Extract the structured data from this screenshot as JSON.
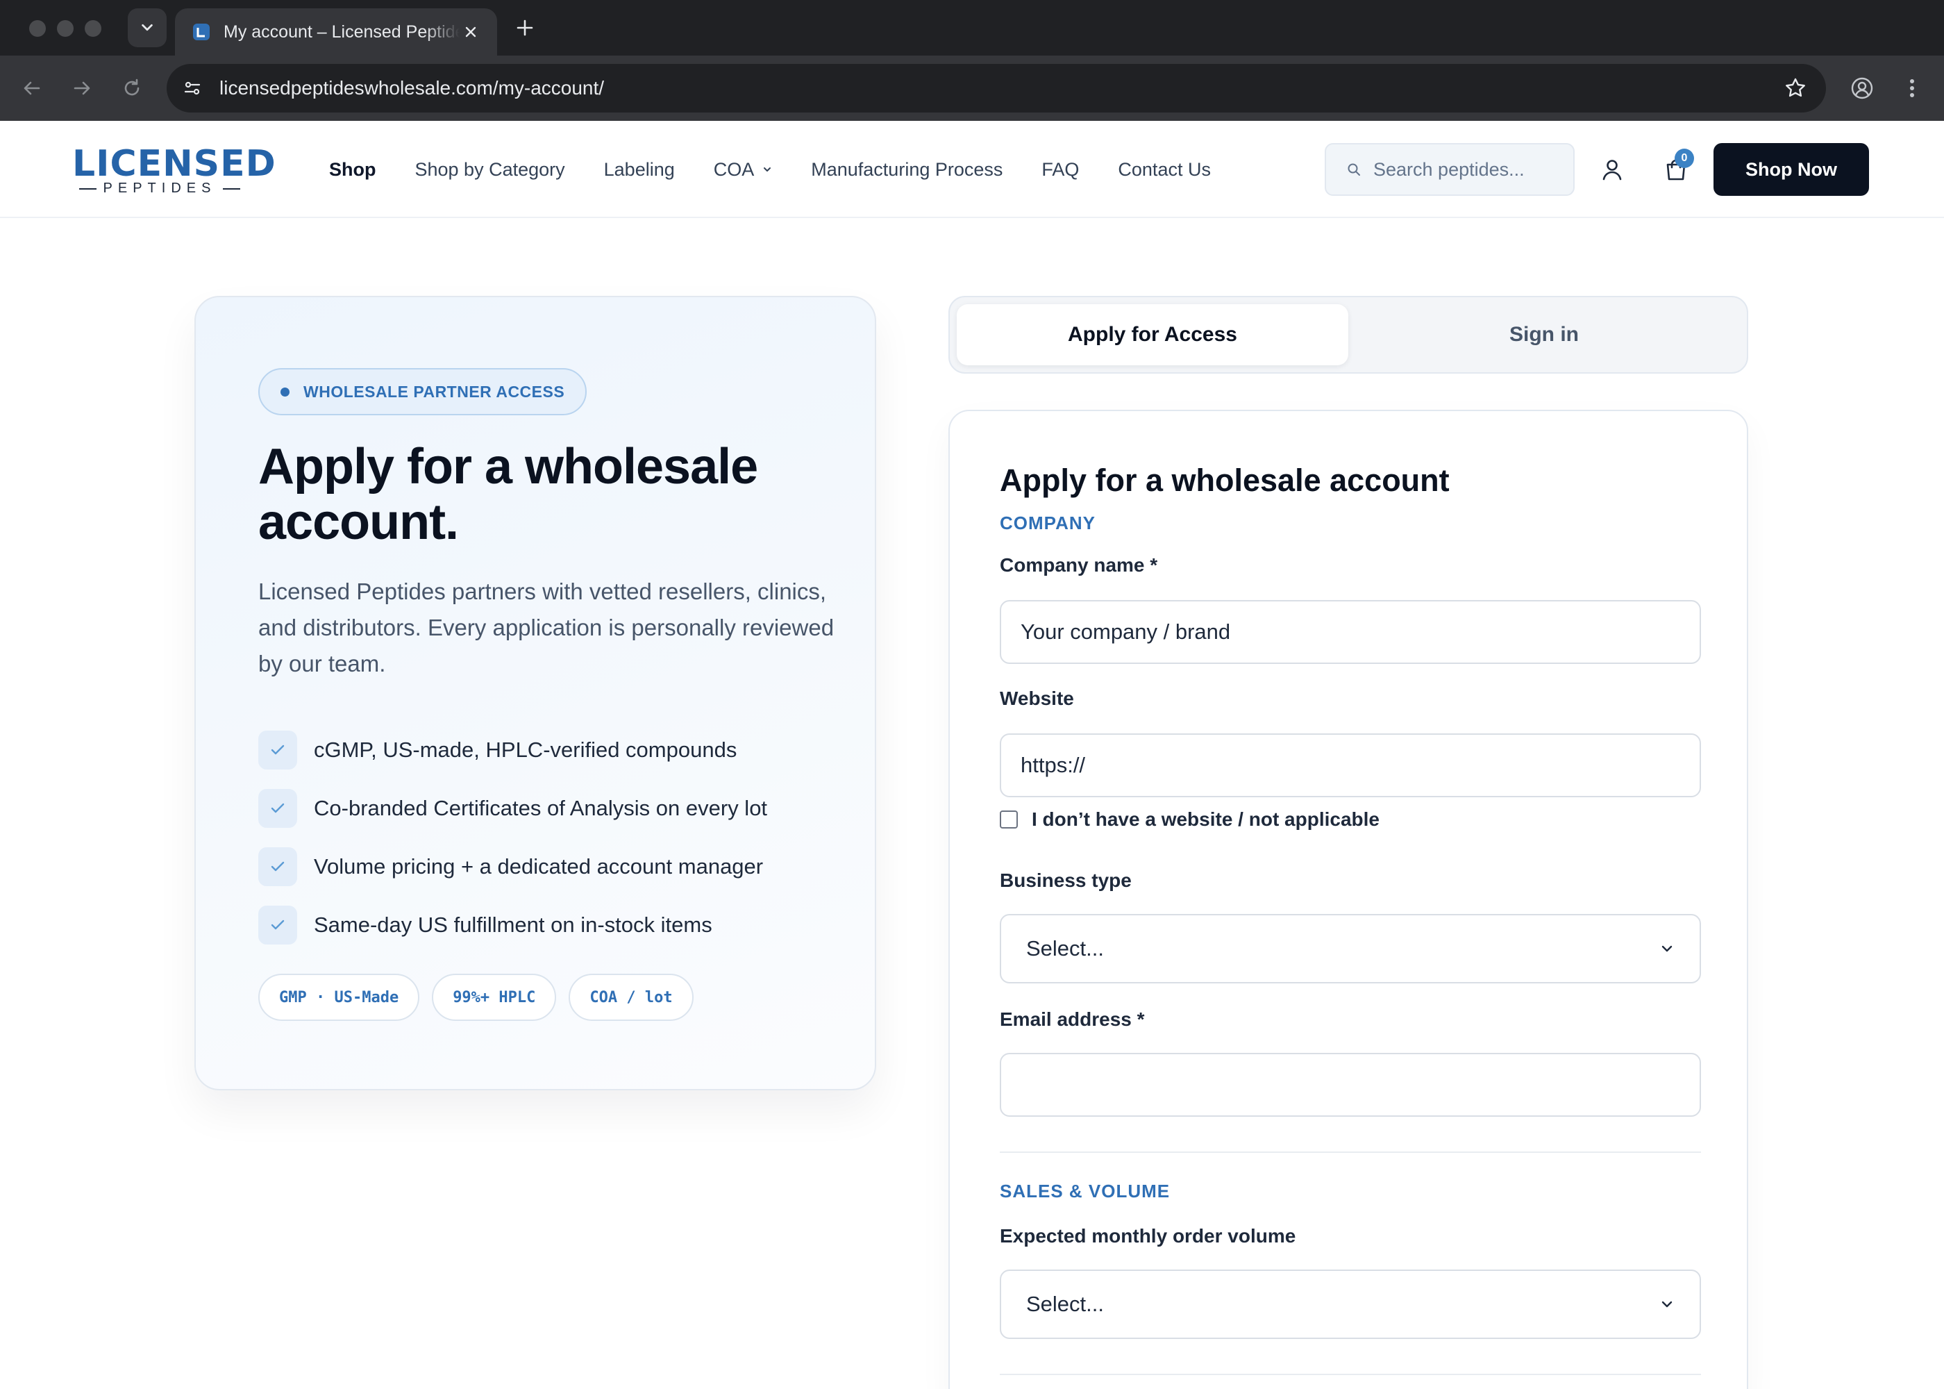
{
  "browser": {
    "tab_title": "My account – Licensed Peptides",
    "url": "licensedpeptideswholesale.com/my-account/"
  },
  "header": {
    "logo_main": "LICENSED",
    "logo_sub": "PEPTIDES",
    "nav": [
      {
        "label": "Shop"
      },
      {
        "label": "Shop by Category"
      },
      {
        "label": "Labeling"
      },
      {
        "label": "COA"
      },
      {
        "label": "Manufacturing Process"
      },
      {
        "label": "FAQ"
      },
      {
        "label": "Contact Us"
      }
    ],
    "search_placeholder": "Search peptides...",
    "cart_count": "0",
    "cta_label": "Shop Now"
  },
  "promo": {
    "badge": "WHOLESALE PARTNER ACCESS",
    "title": "Apply for a wholesale account.",
    "description": "Licensed Peptides partners with vetted resellers, clinics, and distributors. Every application is personally reviewed by our team.",
    "features": [
      "cGMP, US-made, HPLC-verified compounds",
      "Co-branded Certificates of Analysis on every lot",
      "Volume pricing + a dedicated account manager",
      "Same-day US fulfillment on in-stock items"
    ],
    "chips": [
      "GMP · US-Made",
      "99%+ HPLC",
      "COA / lot"
    ]
  },
  "tabs": {
    "apply": "Apply for Access",
    "signin": "Sign in",
    "active": "apply"
  },
  "form": {
    "title": "Apply for a wholesale account",
    "section_company": "COMPANY",
    "company_label": "Company name *",
    "company_placeholder": "Your company / brand",
    "website_label": "Website",
    "website_value": "https://",
    "no_website_label": "I don’t have a website / not applicable",
    "business_type_label": "Business type",
    "business_type_value": "Select...",
    "email_label": "Email address *",
    "email_value": "",
    "section_sales": "SALES & VOLUME",
    "volume_label": "Expected monthly order volume",
    "volume_value": "Select..."
  },
  "colors": {
    "brand_blue": "#2f6fb5",
    "cta_dark": "#0b1220"
  }
}
